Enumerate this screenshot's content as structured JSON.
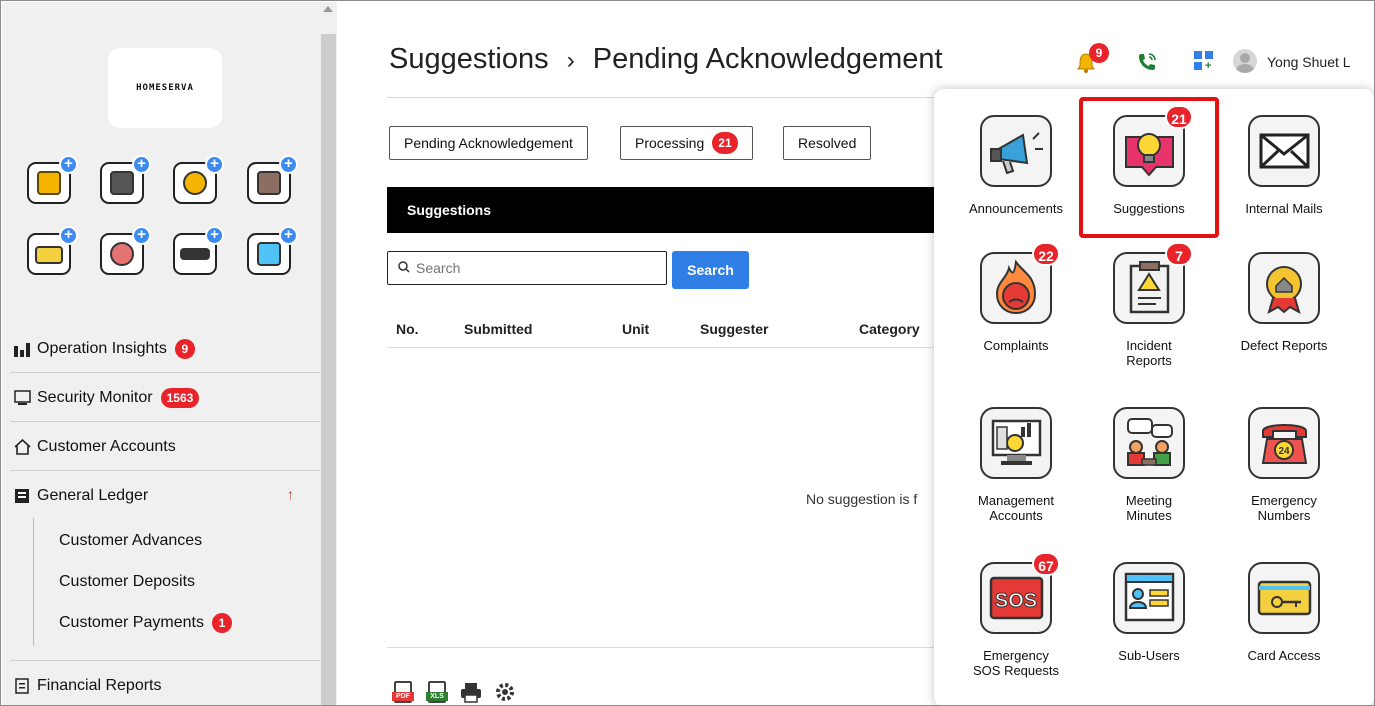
{
  "sidebar": {
    "logo_text": "HOMESERVA",
    "quick_actions": [
      {
        "name": "add-id-card-icon",
        "color": "#f4b400"
      },
      {
        "name": "add-calendar-icon",
        "color": "#555555"
      },
      {
        "name": "add-bank-icon",
        "color": "#f4b400"
      },
      {
        "name": "add-building-icon",
        "color": "#8d6e63"
      },
      {
        "name": "add-key-card-icon",
        "color": "#f4d03f"
      },
      {
        "name": "add-face-icon",
        "color": "#e57373"
      },
      {
        "name": "add-license-plate-icon",
        "color": "#333333"
      },
      {
        "name": "add-login-icon",
        "color": "#4fc3f7"
      }
    ],
    "menu": {
      "operation_insights": {
        "label": "Operation Insights",
        "badge": "9"
      },
      "security_monitor": {
        "label": "Security Monitor",
        "badge": "1563"
      },
      "customer_accounts": {
        "label": "Customer Accounts"
      },
      "general_ledger": {
        "label": "General Ledger",
        "arrow": "↑"
      },
      "customer_advances": {
        "label": "Customer Advances"
      },
      "customer_deposits": {
        "label": "Customer Deposits"
      },
      "customer_payments": {
        "label": "Customer Payments",
        "badge": "1"
      },
      "financial_reports": {
        "label": "Financial Reports"
      }
    }
  },
  "header": {
    "title": "Suggestions",
    "separator": "›",
    "subtitle": "Pending Acknowledgement",
    "notifications_badge": "9",
    "user_name": "Yong Shuet L"
  },
  "tabs": [
    {
      "label": "Pending Acknowledgement"
    },
    {
      "label": "Processing",
      "badge": "21"
    },
    {
      "label": "Resolved"
    }
  ],
  "section_title": "Suggestions",
  "search": {
    "placeholder": "Search",
    "button_label": "Search"
  },
  "table": {
    "columns": [
      "No.",
      "Submitted",
      "Unit",
      "Suggester",
      "Category"
    ],
    "empty_message": "No suggestion is f"
  },
  "export": {
    "pdf": "PDF",
    "xls": "XLS"
  },
  "apps_panel": {
    "tiles": [
      {
        "label": "Announcements",
        "icon": "megaphone-icon"
      },
      {
        "label": "Suggestions",
        "icon": "lightbulb-icon",
        "badge": "21"
      },
      {
        "label": "Internal Mails",
        "icon": "envelope-icon"
      },
      {
        "label": "Complaints",
        "icon": "angry-fire-icon",
        "badge": "22"
      },
      {
        "label": "Incident\nReports",
        "icon": "clipboard-warning-icon",
        "badge": "7"
      },
      {
        "label": "Defect Reports",
        "icon": "house-badge-icon"
      },
      {
        "label": "Management\nAccounts",
        "icon": "financial-monitor-icon"
      },
      {
        "label": "Meeting\nMinutes",
        "icon": "meeting-icon"
      },
      {
        "label": "Emergency\nNumbers",
        "icon": "emergency-phone-icon"
      },
      {
        "label": "Emergency\nSOS Requests",
        "icon": "sos-icon",
        "badge": "67"
      },
      {
        "label": "Sub-Users",
        "icon": "login-window-icon"
      },
      {
        "label": "Card Access",
        "icon": "key-card-icon"
      }
    ]
  },
  "colors": {
    "accent_blue": "#2f7fe6",
    "badge_red": "#e8232a",
    "highlight_red": "#e31111"
  }
}
